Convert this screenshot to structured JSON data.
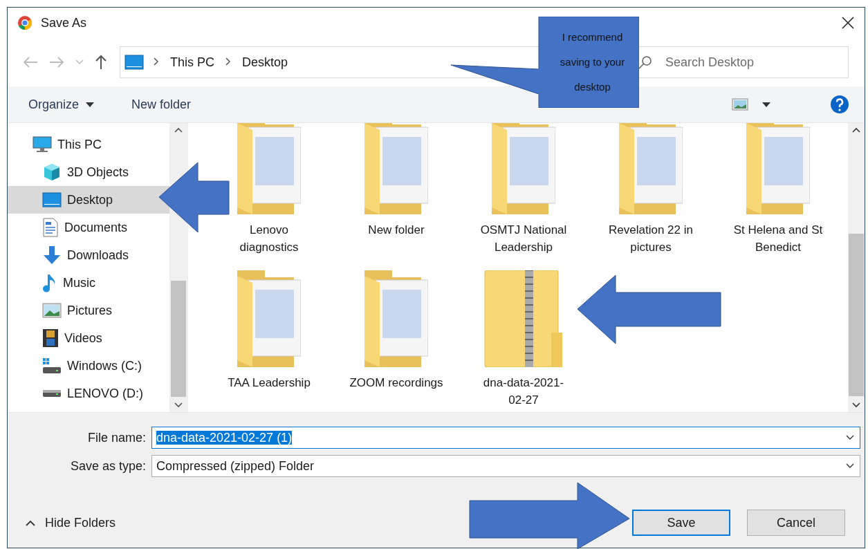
{
  "window": {
    "title": "Save As"
  },
  "address_bar": {
    "crumbs": [
      "This PC",
      "Desktop"
    ]
  },
  "search": {
    "placeholder": "Search Desktop"
  },
  "toolbar": {
    "organize": "Organize",
    "new_folder": "New folder"
  },
  "navigation_pane": {
    "items": [
      {
        "kind": "pc",
        "label": "This PC",
        "selected": false
      },
      {
        "kind": "cube",
        "label": "3D Objects",
        "selected": false
      },
      {
        "kind": "desktop",
        "label": "Desktop",
        "selected": true
      },
      {
        "kind": "document",
        "label": "Documents",
        "selected": false
      },
      {
        "kind": "download",
        "label": "Downloads",
        "selected": false
      },
      {
        "kind": "music",
        "label": "Music",
        "selected": false
      },
      {
        "kind": "picture",
        "label": "Pictures",
        "selected": false
      },
      {
        "kind": "video",
        "label": "Videos",
        "selected": false
      },
      {
        "kind": "system_drive",
        "label": "Windows (C:)",
        "selected": false
      },
      {
        "kind": "drive",
        "label": "LENOVO (D:)",
        "selected": false
      }
    ]
  },
  "files": [
    {
      "kind": "folder",
      "name": "Lenovo diagnostics"
    },
    {
      "kind": "folder",
      "name": "New folder"
    },
    {
      "kind": "folder",
      "name": "OSMTJ National Leadership"
    },
    {
      "kind": "folder",
      "name": "Revelation 22 in pictures"
    },
    {
      "kind": "folder",
      "name": "St Helena and St Benedict"
    },
    {
      "kind": "folder",
      "name": "TAA Leadership"
    },
    {
      "kind": "folder",
      "name": "ZOOM recordings"
    },
    {
      "kind": "zip",
      "name": "dna-data-2021-02-27"
    }
  ],
  "file_name": {
    "label": "File name:",
    "value": "dna-data-2021-02-27 (1)",
    "text_selected": true
  },
  "save_as_type": {
    "label": "Save as type:",
    "value": "Compressed (zipped) Folder"
  },
  "hide_folders": "Hide Folders",
  "buttons": [
    {
      "label": "Save",
      "default": true
    },
    {
      "label": "Cancel",
      "default": false
    }
  ],
  "callout": {
    "text": "I recommend saving to your desktop"
  }
}
